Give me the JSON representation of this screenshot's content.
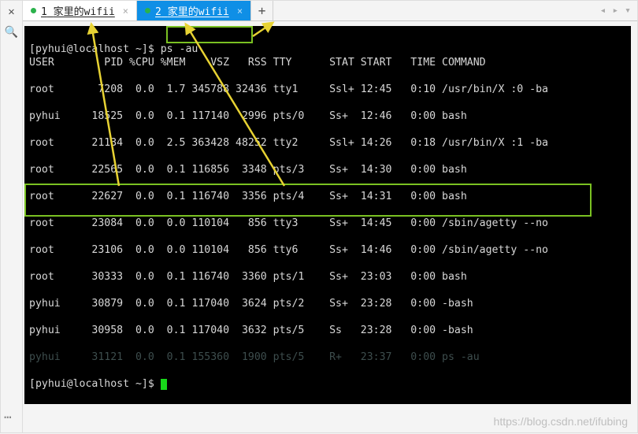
{
  "gutter": {
    "close_glyph": "✕",
    "search_glyph": "🔍"
  },
  "tabs": {
    "items": [
      {
        "num": "1",
        "label": "家里的wifii",
        "active": false
      },
      {
        "num": "2",
        "label": "家里的wifii",
        "active": true
      }
    ],
    "new_tab_glyph": "+",
    "nav_left": "◂",
    "nav_right": "▸",
    "menu_glyph": "▾"
  },
  "terminal": {
    "prompt1_left": "[pyhui@localhost ~]$ ",
    "prompt1_cmd": "ps -au",
    "header": "USER        PID %CPU %MEM    VSZ   RSS TTY      STAT START   TIME COMMAND",
    "rows": [
      "root       7208  0.0  1.7 345788 32436 tty1     Ssl+ 12:45   0:10 /usr/bin/X :0 -ba",
      "pyhui     18525  0.0  0.1 117140  2996 pts/0    Ss+  12:46   0:00 bash",
      "root      21134  0.0  2.5 363428 48252 tty2     Ssl+ 14:26   0:18 /usr/bin/X :1 -ba",
      "root      22565  0.0  0.1 116856  3348 pts/3    Ss+  14:30   0:00 bash",
      "root      22627  0.0  0.1 116740  3356 pts/4    Ss+  14:31   0:00 bash",
      "root      23084  0.0  0.0 110104   856 tty3     Ss+  14:45   0:00 /sbin/agetty --no",
      "root      23106  0.0  0.0 110104   856 tty6     Ss+  14:46   0:00 /sbin/agetty --no",
      "root      30333  0.0  0.1 116740  3360 pts/1    Ss+  23:03   0:00 bash",
      "pyhui     30879  0.0  0.1 117040  3624 pts/2    Ss+  23:28   0:00 -bash",
      "pyhui     30958  0.0  0.1 117040  3632 pts/5    Ss   23:28   0:00 -bash",
      "pyhui     31121  0.0  0.1 155360  1900 pts/5    R+   23:37   0:00 ps -au"
    ],
    "prompt2": "[pyhui@localhost ~]$ "
  },
  "footer": {
    "ellipsis": "…",
    "watermark": "https://blog.csdn.net/ifubing"
  }
}
